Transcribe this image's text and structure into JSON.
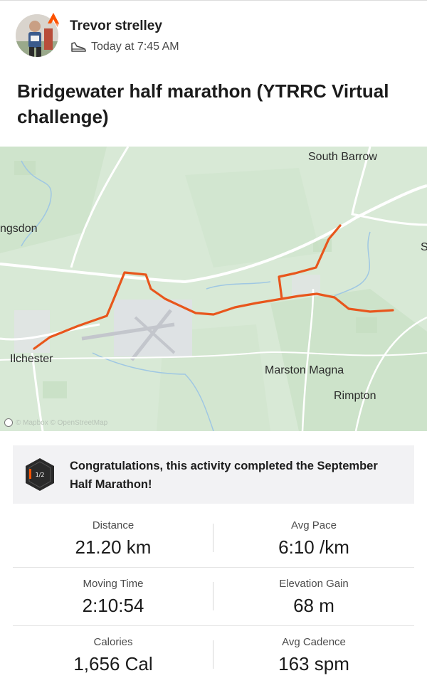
{
  "post": {
    "author": "Trevor strelley",
    "timestamp": "Today at 7:45 AM",
    "activity_icon": "shoe-icon",
    "title": "Bridgewater half marathon (YTRRC Virtual challenge)"
  },
  "map": {
    "labels": {
      "south_barrow": "South Barrow",
      "ngsdon": "ngsdon",
      "s": "S",
      "ilchester": "Ilchester",
      "marston_magna": "Marston Magna",
      "rimpton": "Rimpton"
    },
    "attribution": "© Mapbox © OpenStreetMap",
    "route_color": "#e8561c"
  },
  "achievement": {
    "badge_text": "1/2",
    "text": "Congratulations, this activity completed the September Half Marathon!"
  },
  "stats": {
    "distance": {
      "label": "Distance",
      "value": "21.20 km"
    },
    "avg_pace": {
      "label": "Avg Pace",
      "value": "6:10 /km"
    },
    "moving_time": {
      "label": "Moving Time",
      "value": "2:10:54"
    },
    "elevation_gain": {
      "label": "Elevation Gain",
      "value": "68 m"
    },
    "calories": {
      "label": "Calories",
      "value": "1,656 Cal"
    },
    "avg_cadence": {
      "label": "Avg Cadence",
      "value": "163 spm"
    }
  }
}
